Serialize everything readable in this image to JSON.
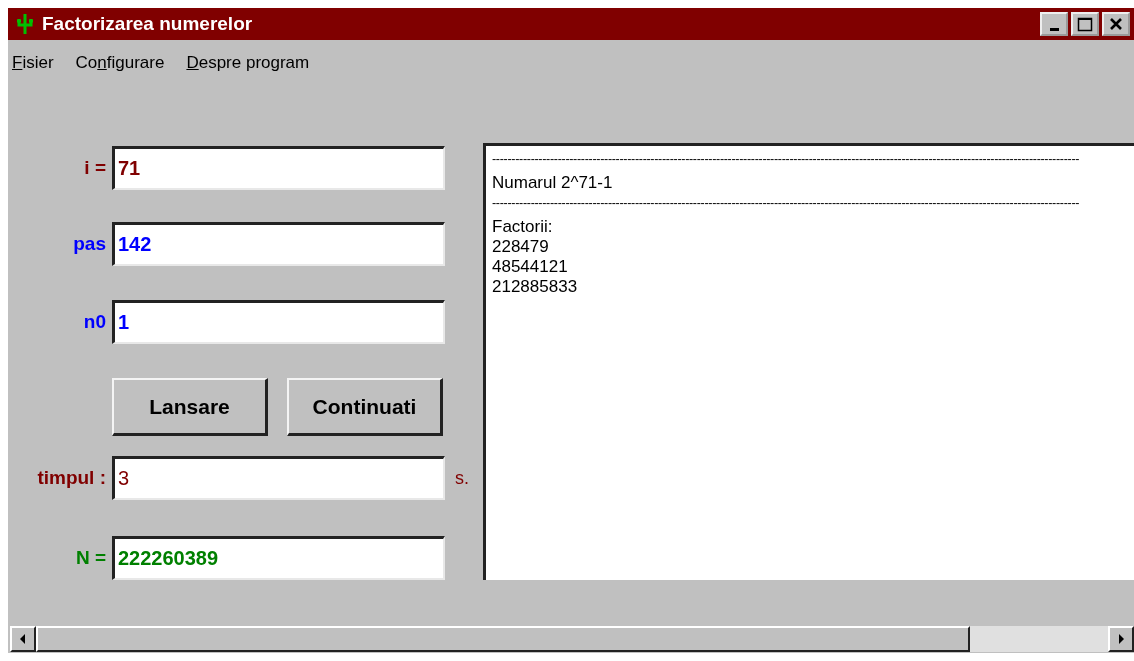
{
  "window": {
    "title": "Factorizarea numerelor"
  },
  "menu": [
    {
      "key": "F",
      "after": "isier"
    },
    {
      "before": "Co",
      "key": "n",
      "after": "figurare"
    },
    {
      "key": "D",
      "after": "espre program"
    }
  ],
  "fields": [
    {
      "label": "i =",
      "value": "71",
      "color": "#800000",
      "bold": true
    },
    {
      "label": "pas",
      "value": "142",
      "color": "#0000ff",
      "bold": true
    },
    {
      "label": "n0",
      "value": "1",
      "color": "#0000ff",
      "bold": true
    },
    {
      "kind": "buttons",
      "buttons": [
        "Lansare",
        "Continuati"
      ]
    },
    {
      "label": "timpul :",
      "value": "3",
      "color": "#800000",
      "bold": false,
      "suffix": "s."
    },
    {
      "label": "N =",
      "value": "222260389",
      "color": "#008000",
      "bold": true
    }
  ],
  "output": [
    {
      "kind": "rule",
      "text": "--------------------------------------------------------------------------------------------------------------------------------------------------------"
    },
    {
      "kind": "text",
      "text": "Numarul 2^71-1"
    },
    {
      "kind": "rule",
      "text": "--------------------------------------------------------------------------------------------------------------------------------------------------------"
    },
    {
      "kind": "text",
      "text": "Factorii:"
    },
    {
      "kind": "text",
      "text": "228479"
    },
    {
      "kind": "text",
      "text": "48544121"
    },
    {
      "kind": "text",
      "text": "212885833"
    }
  ]
}
